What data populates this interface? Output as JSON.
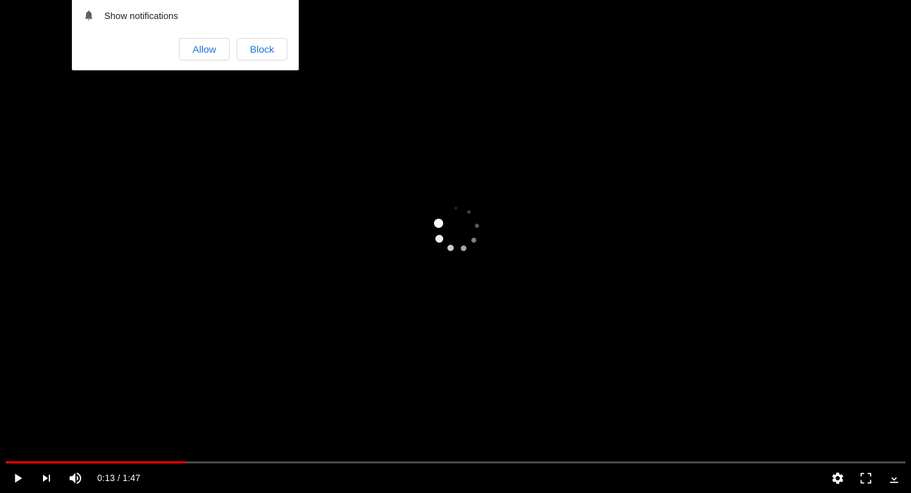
{
  "notification": {
    "text": "Show notifications",
    "allow_label": "Allow",
    "block_label": "Block"
  },
  "player": {
    "current_time": "0:13",
    "duration": "1:47",
    "time_separator": " / ",
    "progress_percent": 20,
    "colors": {
      "progress_played": "#ff0000",
      "button_primary": "#1a73e8"
    }
  }
}
